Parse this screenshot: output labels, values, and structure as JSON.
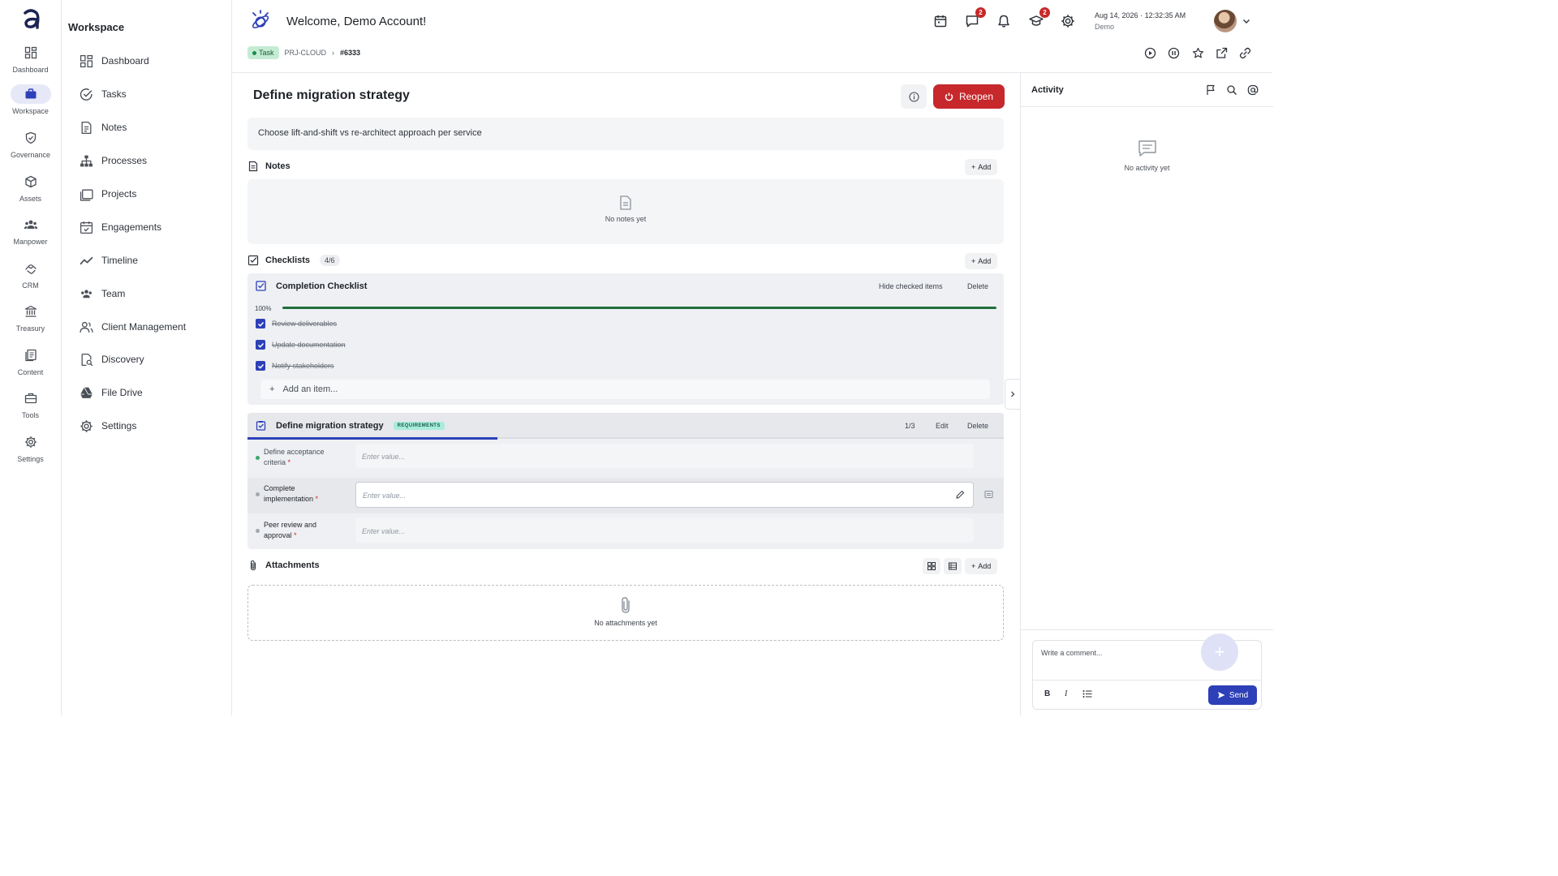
{
  "rail": {
    "logo": "a-logo",
    "items": [
      {
        "label": "Dashboard",
        "icon": "dashboard-icon"
      },
      {
        "label": "Workspace",
        "icon": "briefcase-icon",
        "active": true
      },
      {
        "label": "Governance",
        "icon": "shield-check-icon"
      },
      {
        "label": "Assets",
        "icon": "cube-icon"
      },
      {
        "label": "Manpower",
        "icon": "people-icon"
      },
      {
        "label": "CRM",
        "icon": "handshake-icon"
      },
      {
        "label": "Treasury",
        "icon": "bank-icon"
      },
      {
        "label": "Content",
        "icon": "documents-icon"
      },
      {
        "label": "Tools",
        "icon": "toolbox-icon"
      },
      {
        "label": "Settings",
        "icon": "gear-icon"
      }
    ]
  },
  "sidebar": {
    "title": "Workspace",
    "items": [
      {
        "label": "Dashboard",
        "icon": "dashboard-icon"
      },
      {
        "label": "Tasks",
        "icon": "check-circle-icon"
      },
      {
        "label": "Notes",
        "icon": "note-icon"
      },
      {
        "label": "Processes",
        "icon": "hierarchy-icon"
      },
      {
        "label": "Projects",
        "icon": "folders-icon"
      },
      {
        "label": "Engagements",
        "icon": "calendar-check-icon"
      },
      {
        "label": "Timeline",
        "icon": "trend-icon"
      },
      {
        "label": "Team",
        "icon": "team-icon"
      },
      {
        "label": "Client Management",
        "icon": "clients-icon"
      },
      {
        "label": "Discovery",
        "icon": "search-document-icon"
      },
      {
        "label": "File Drive",
        "icon": "drive-icon"
      },
      {
        "label": "Settings",
        "icon": "gear-icon"
      }
    ]
  },
  "header": {
    "welcome": "Welcome, Demo Account!",
    "messages_badge": "2",
    "learning_badge": "2",
    "date": "Aug 14, 2026",
    "time": "12:32:35 AM",
    "date_separator": "·",
    "user": "Demo"
  },
  "breadcrumb": {
    "tag": "Task",
    "project": "PRJ-CLOUD",
    "separator": "›",
    "id": "#6333"
  },
  "task": {
    "title": "Define migration strategy",
    "reopen_label": "Reopen",
    "description": "Choose lift-and-shift vs re-architect approach per service"
  },
  "notes": {
    "title": "Notes",
    "add_label": "Add",
    "empty": "No notes yet"
  },
  "checklists": {
    "title": "Checklists",
    "count": "4/6",
    "add_label": "Add",
    "completion": {
      "title": "Completion Checklist",
      "hide_label": "Hide checked items",
      "delete_label": "Delete",
      "percent_label": "100%",
      "progress": 1.0,
      "items": [
        {
          "label": "Review deliverables",
          "checked": true
        },
        {
          "label": "Update documentation",
          "checked": true
        },
        {
          "label": "Notify stakeholders",
          "checked": true
        }
      ],
      "add_item_placeholder": "Add an item..."
    },
    "requirements": {
      "title": "Define migration strategy",
      "badge": "REQUIREMENTS",
      "count": "1/3",
      "edit_label": "Edit",
      "delete_label": "Delete",
      "rows": [
        {
          "label": "Define acceptance criteria",
          "required": "*",
          "placeholder": "Enter value...",
          "status": "done"
        },
        {
          "label": "Complete implementation",
          "required": "*",
          "placeholder": "Enter value...",
          "status": "pending"
        },
        {
          "label": "Peer review and approval",
          "required": "*",
          "placeholder": "Enter value...",
          "status": "pending"
        }
      ]
    }
  },
  "attachments": {
    "title": "Attachments",
    "add_label": "Add",
    "empty": "No attachments yet"
  },
  "activity": {
    "title": "Activity",
    "empty": "No activity yet",
    "comment_placeholder": "Write a comment...",
    "send_label": "Send",
    "fab_label": "+",
    "format": {
      "bold": "B",
      "italic": "I"
    }
  },
  "colors": {
    "accent": "#2d40b8",
    "danger": "#c6282b",
    "success": "#1f6f3c",
    "task_tag": "#c4ecd4"
  }
}
